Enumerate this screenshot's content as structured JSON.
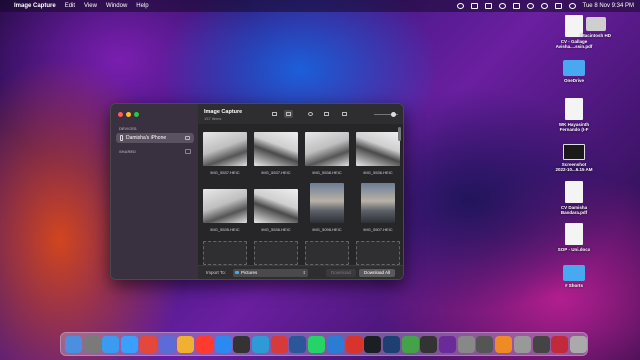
{
  "menubar": {
    "app_name": "Image Capture",
    "menus": [
      "Edit",
      "View",
      "Window",
      "Help"
    ],
    "clock": "Tue 8 Nov  9:34 PM"
  },
  "desktop_icons": [
    {
      "label": "CV - Gallage\nAvisha....ssin.pdf",
      "kind": "doc"
    },
    {
      "label": "Macintosh HD",
      "kind": "drive"
    },
    {
      "label": "OneDrive",
      "kind": "folder"
    },
    {
      "label": "WK Hayasinth\nFernando (I-F",
      "kind": "doc"
    },
    {
      "label": "Screenshot\n2022-10...6.15 AM",
      "kind": "shot"
    },
    {
      "label": "CV Damisha\nBandara.pdf",
      "kind": "doc"
    },
    {
      "label": "SOP - Uni.docx",
      "kind": "doc"
    },
    {
      "label": "# Shorts",
      "kind": "folder"
    }
  ],
  "window": {
    "title": "Image Capture",
    "subtitle": "157 items",
    "sidebar": {
      "devices_header": "DEVICES",
      "device_name": "Damisha's iPhone",
      "shared_header": "SHARED"
    },
    "photos": [
      {
        "name": "IMG_5537.HEIC",
        "kind": "desk"
      },
      {
        "name": "IMG_5537.HEIC",
        "kind": "desk2"
      },
      {
        "name": "IMG_5538.HEIC",
        "kind": "desk"
      },
      {
        "name": "IMG_5536.HEIC",
        "kind": "desk2"
      },
      {
        "name": "IMG_5535.HEIC",
        "kind": "desk"
      },
      {
        "name": "IMG_5536.HEIC",
        "kind": "desk2"
      },
      {
        "name": "IMG_5098.HEIC",
        "kind": "sky"
      },
      {
        "name": "IMG_5507.HEIC",
        "kind": "sky"
      }
    ],
    "import_to_label": "Import To:",
    "import_to_value": "Pictures",
    "download_label": "Download",
    "download_all_label": "Download All"
  },
  "dock_colors": [
    "#4a8fe0",
    "#7a7a7a",
    "#3b9bf0",
    "#3aa0ff",
    "#e5473b",
    "#5b6cd8",
    "#f0b030",
    "#ff3b30",
    "#2b8af0",
    "#333333",
    "#2e9ad6",
    "#d83a3a",
    "#2b579a",
    "#25d366",
    "#2b7cd3",
    "#d8332c",
    "#1b1f23",
    "#1d3f72",
    "#44a248",
    "#333",
    "#6a2b9a",
    "#888",
    "#555",
    "#f08a24",
    "#999",
    "#444",
    "#c02a3a",
    "#aaaaaa"
  ]
}
